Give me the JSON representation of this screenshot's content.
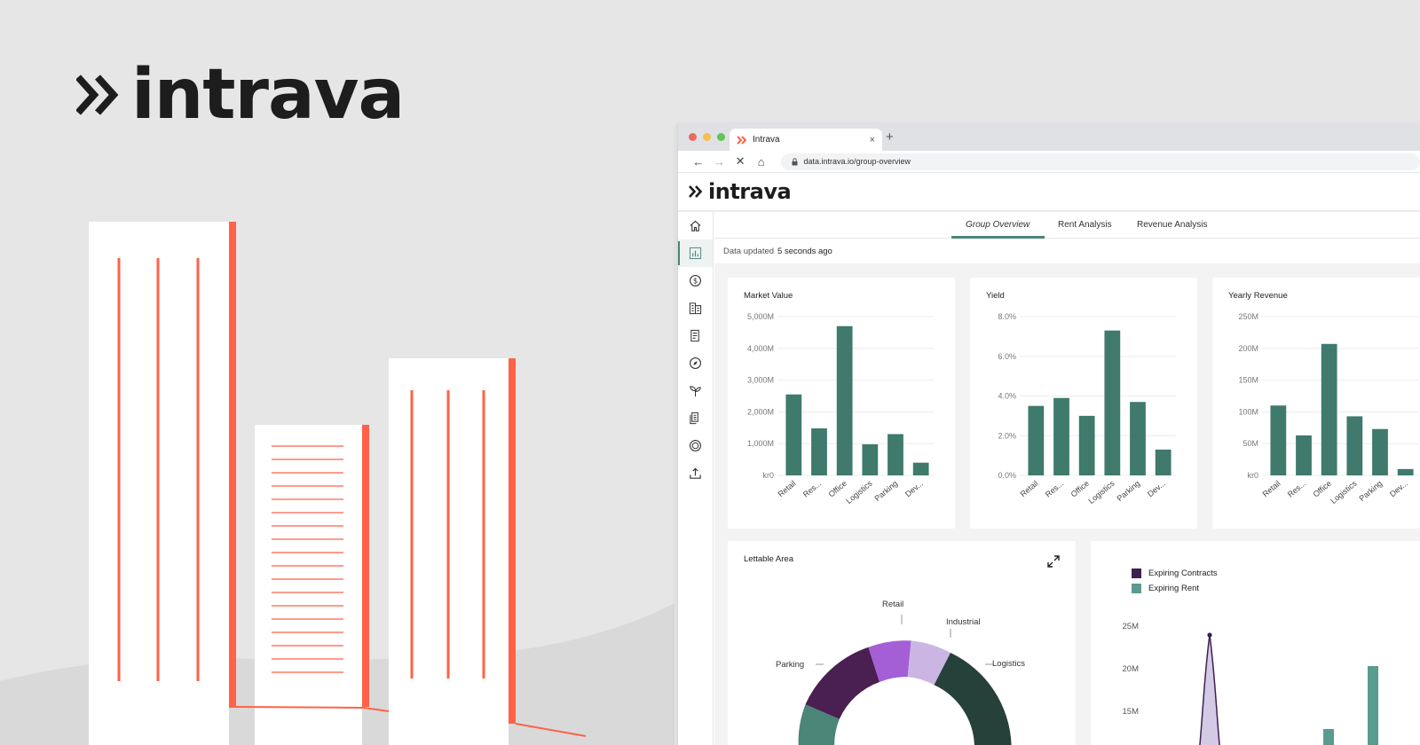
{
  "hero": {
    "brand": "intrava"
  },
  "browser": {
    "tab_title": "Intrava",
    "tab_close": "×",
    "new_tab": "+",
    "url": "data.intrava.io/group-overview",
    "dots": [
      "#ed6a5e",
      "#f5bf4f",
      "#61c554"
    ]
  },
  "app": {
    "brand": "intrava",
    "tabs": [
      "Group Overview",
      "Rent Analysis",
      "Revenue Analysis"
    ],
    "updated_label": "Data updated",
    "updated_value": "5 seconds ago",
    "sidebar_icons": [
      "home-icon",
      "bar-chart-icon",
      "dollar-icon",
      "buildings-icon",
      "report-icon",
      "compass-icon",
      "plant-icon",
      "documents-icon",
      "badge-icon",
      "upload-icon"
    ],
    "accent": "#4a8578"
  },
  "chart_data": [
    {
      "type": "bar",
      "title": "Market Value",
      "categories": [
        "Retail",
        "Res...",
        "Office",
        "Logistics",
        "Parking",
        "Dev..."
      ],
      "values": [
        2550,
        1480,
        4700,
        980,
        1300,
        400
      ],
      "ylim": [
        0,
        5000
      ],
      "yticks": [
        "kr0",
        "1,000M",
        "2,000M",
        "3,000M",
        "4,000M",
        "5,000M"
      ],
      "color": "#3f7a6c"
    },
    {
      "type": "bar",
      "title": "Yield",
      "categories": [
        "Retail",
        "Res...",
        "Office",
        "Logistics",
        "Parking",
        "Dev..."
      ],
      "values": [
        3.5,
        3.9,
        3.0,
        7.3,
        3.7,
        1.3
      ],
      "ylim": [
        0,
        8
      ],
      "yticks": [
        "0.0%",
        "2.0%",
        "4.0%",
        "6.0%",
        "8.0%"
      ],
      "color": "#3f7a6c"
    },
    {
      "type": "bar",
      "title": "Yearly Revenue",
      "categories": [
        "Retail",
        "Res...",
        "Office",
        "Logistics",
        "Parking",
        "Dev..."
      ],
      "values": [
        110,
        63,
        207,
        93,
        73,
        10
      ],
      "ylim": [
        0,
        250
      ],
      "yticks": [
        "kr0",
        "50M",
        "100M",
        "150M",
        "200M",
        "250M"
      ],
      "color": "#3f7a6c"
    },
    {
      "type": "pie",
      "title": "Lettable Area",
      "labels": [
        "Parking",
        "Retail",
        "Industrial",
        "Logistics"
      ],
      "colors": [
        "#4a8578",
        "#4a1f52",
        "#a45fd6",
        "#cbb6e3",
        "#26403a"
      ]
    },
    {
      "type": "line",
      "legend": [
        "Expiring Contracts",
        "Expiring Rent"
      ],
      "legend_colors": [
        "#3b2150",
        "#5a9b8f"
      ],
      "yticks": [
        "15M",
        "20M",
        "25M"
      ],
      "peak_contracts": 25.5,
      "rent_bar": 20.5
    }
  ]
}
